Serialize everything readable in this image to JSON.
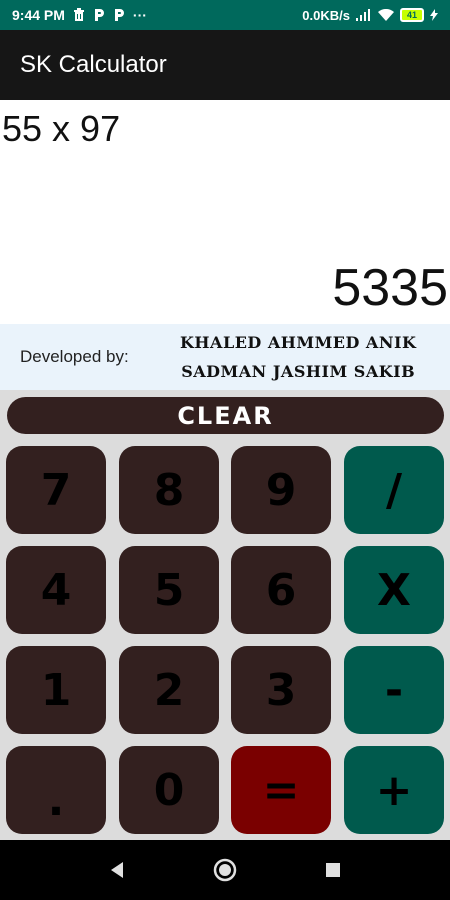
{
  "status_bar": {
    "time": "9:44 PM",
    "more": "···",
    "net_speed": "0.0KB/s",
    "battery": "41"
  },
  "app_bar": {
    "title": "SK Calculator"
  },
  "display": {
    "expression": "55 x 97",
    "result": "5335"
  },
  "credits": {
    "label": "Developed by:",
    "names": [
      "KHALED AHMMED ANIK",
      "SADMAN JASHIM SAKIB"
    ]
  },
  "keypad": {
    "clear": "CLEAR",
    "keys": [
      "7",
      "8",
      "9",
      "/",
      "4",
      "5",
      "6",
      "X",
      "1",
      "2",
      "3",
      "-",
      ".",
      "0",
      "=",
      "+"
    ]
  },
  "colors": {
    "status_bar": "#00695c",
    "app_bar": "#161616",
    "number_key": "#33201f",
    "operator_key": "#005a4d",
    "equals_key": "#7a0000"
  }
}
